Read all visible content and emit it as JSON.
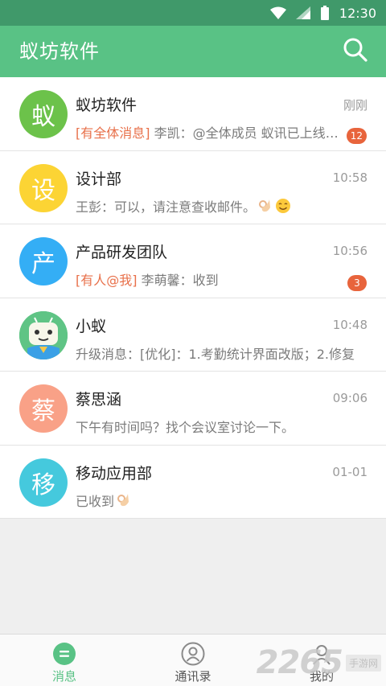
{
  "status_bar": {
    "time": "12:30"
  },
  "app_bar": {
    "title": "蚁坊软件",
    "search_icon": "search-icon"
  },
  "conversations": [
    {
      "name": "蚁坊软件",
      "time": "刚刚",
      "avatar_text": "蚁",
      "avatar_color": "#6cc24a",
      "tag": "[有全体消息]",
      "preview": " 李凯：@全体成员 蚁讯已上线，大家快来体验吧",
      "badge": "12"
    },
    {
      "name": "设计部",
      "time": "10:58",
      "avatar_text": "设",
      "avatar_color": "#fcd434",
      "tag": "",
      "preview": "王彭：可以，请注意查收邮件。",
      "emoji": [
        "ok-hand-emoji",
        "smile-emoji"
      ]
    },
    {
      "name": "产品研发团队",
      "time": "10:56",
      "avatar_text": "产",
      "avatar_color": "#34aef5",
      "tag": "[有人@我]",
      "preview": " 李萌馨：收到",
      "badge": "3"
    },
    {
      "name": "小蚁",
      "time": "10:48",
      "avatar_text": "",
      "avatar_color": "#5fc485",
      "tag": "",
      "preview": "升级消息：[优化]：1.考勤统计界面改版；2.修复"
    },
    {
      "name": "蔡思涵",
      "time": "09:06",
      "avatar_text": "蔡",
      "avatar_color": "#f9a187",
      "tag": "",
      "preview": "下午有时间吗？找个会议室讨论一下。"
    },
    {
      "name": "移动应用部",
      "time": "01-01",
      "avatar_text": "移",
      "avatar_color": "#45c9dd",
      "tag": "",
      "preview": "已收到",
      "emoji": [
        "ok-hand-emoji"
      ]
    }
  ],
  "bottom_nav": [
    {
      "label": "消息",
      "icon": "message-icon",
      "active": true
    },
    {
      "label": "通讯录",
      "icon": "contacts-icon",
      "active": false
    },
    {
      "label": "我的",
      "icon": "profile-icon",
      "active": false
    }
  ],
  "watermark": {
    "number": "2265",
    "text": "手游网"
  },
  "colors": {
    "status_bar": "#40996a",
    "app_bar": "#59c285",
    "accent": "#59c285",
    "tag": "#e8704a",
    "badge": "#e8643c"
  }
}
